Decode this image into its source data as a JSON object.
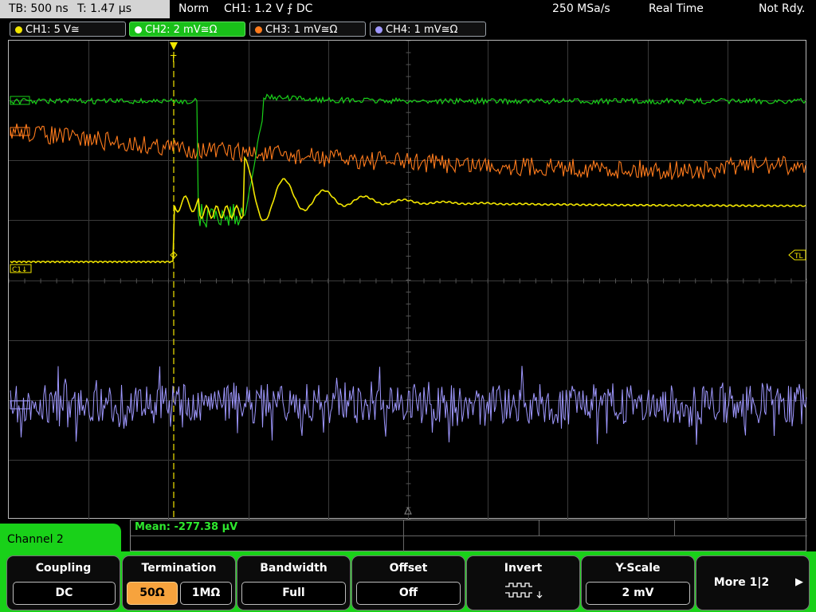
{
  "timebase": {
    "tb_label": "TB: 500 ns",
    "trigger_time": "T: 1.47 µs"
  },
  "status": {
    "mode": "Norm",
    "trigger_info": "CH1: 1.2 V ⨍ DC",
    "sample_rate": "250 MSa/s",
    "acq_mode": "Real Time",
    "ready_state": "Not Rdy."
  },
  "channel_tabs": [
    {
      "label": "CH1: 5 V≅",
      "color": "#f2e600",
      "active": false
    },
    {
      "label": "CH2: 2 mV≅Ω",
      "color": "#ffffff",
      "active": true
    },
    {
      "label": "CH3: 1 mV≅Ω",
      "color": "#ff7b1c",
      "active": false
    },
    {
      "label": "CH4: 1 mV≅Ω",
      "color": "#9f98ff",
      "active": false
    }
  ],
  "markers": {
    "ch1": "C1↓",
    "trigger_level": "◁TL"
  },
  "measurement": {
    "mean": "Mean: -277.38 µV"
  },
  "menu": {
    "title": "Channel 2",
    "coupling": {
      "title": "Coupling",
      "value": "DC"
    },
    "termination": {
      "title": "Termination",
      "option_a": "50Ω",
      "option_b": "1MΩ"
    },
    "bandwidth": {
      "title": "Bandwidth",
      "value": "Full"
    },
    "offset": {
      "title": "Offset",
      "value": "Off"
    },
    "invert": {
      "title": "Invert",
      "icon": "invert-waveform-icon"
    },
    "yscale": {
      "title": "Y-Scale",
      "value": "2 mV"
    },
    "more": {
      "label": "More 1|2"
    }
  },
  "colors": {
    "ch1": "#f2e600",
    "ch2": "#19d119",
    "ch3": "#ff7b1c",
    "ch4": "#9f98ff",
    "accent": "#19d119"
  }
}
